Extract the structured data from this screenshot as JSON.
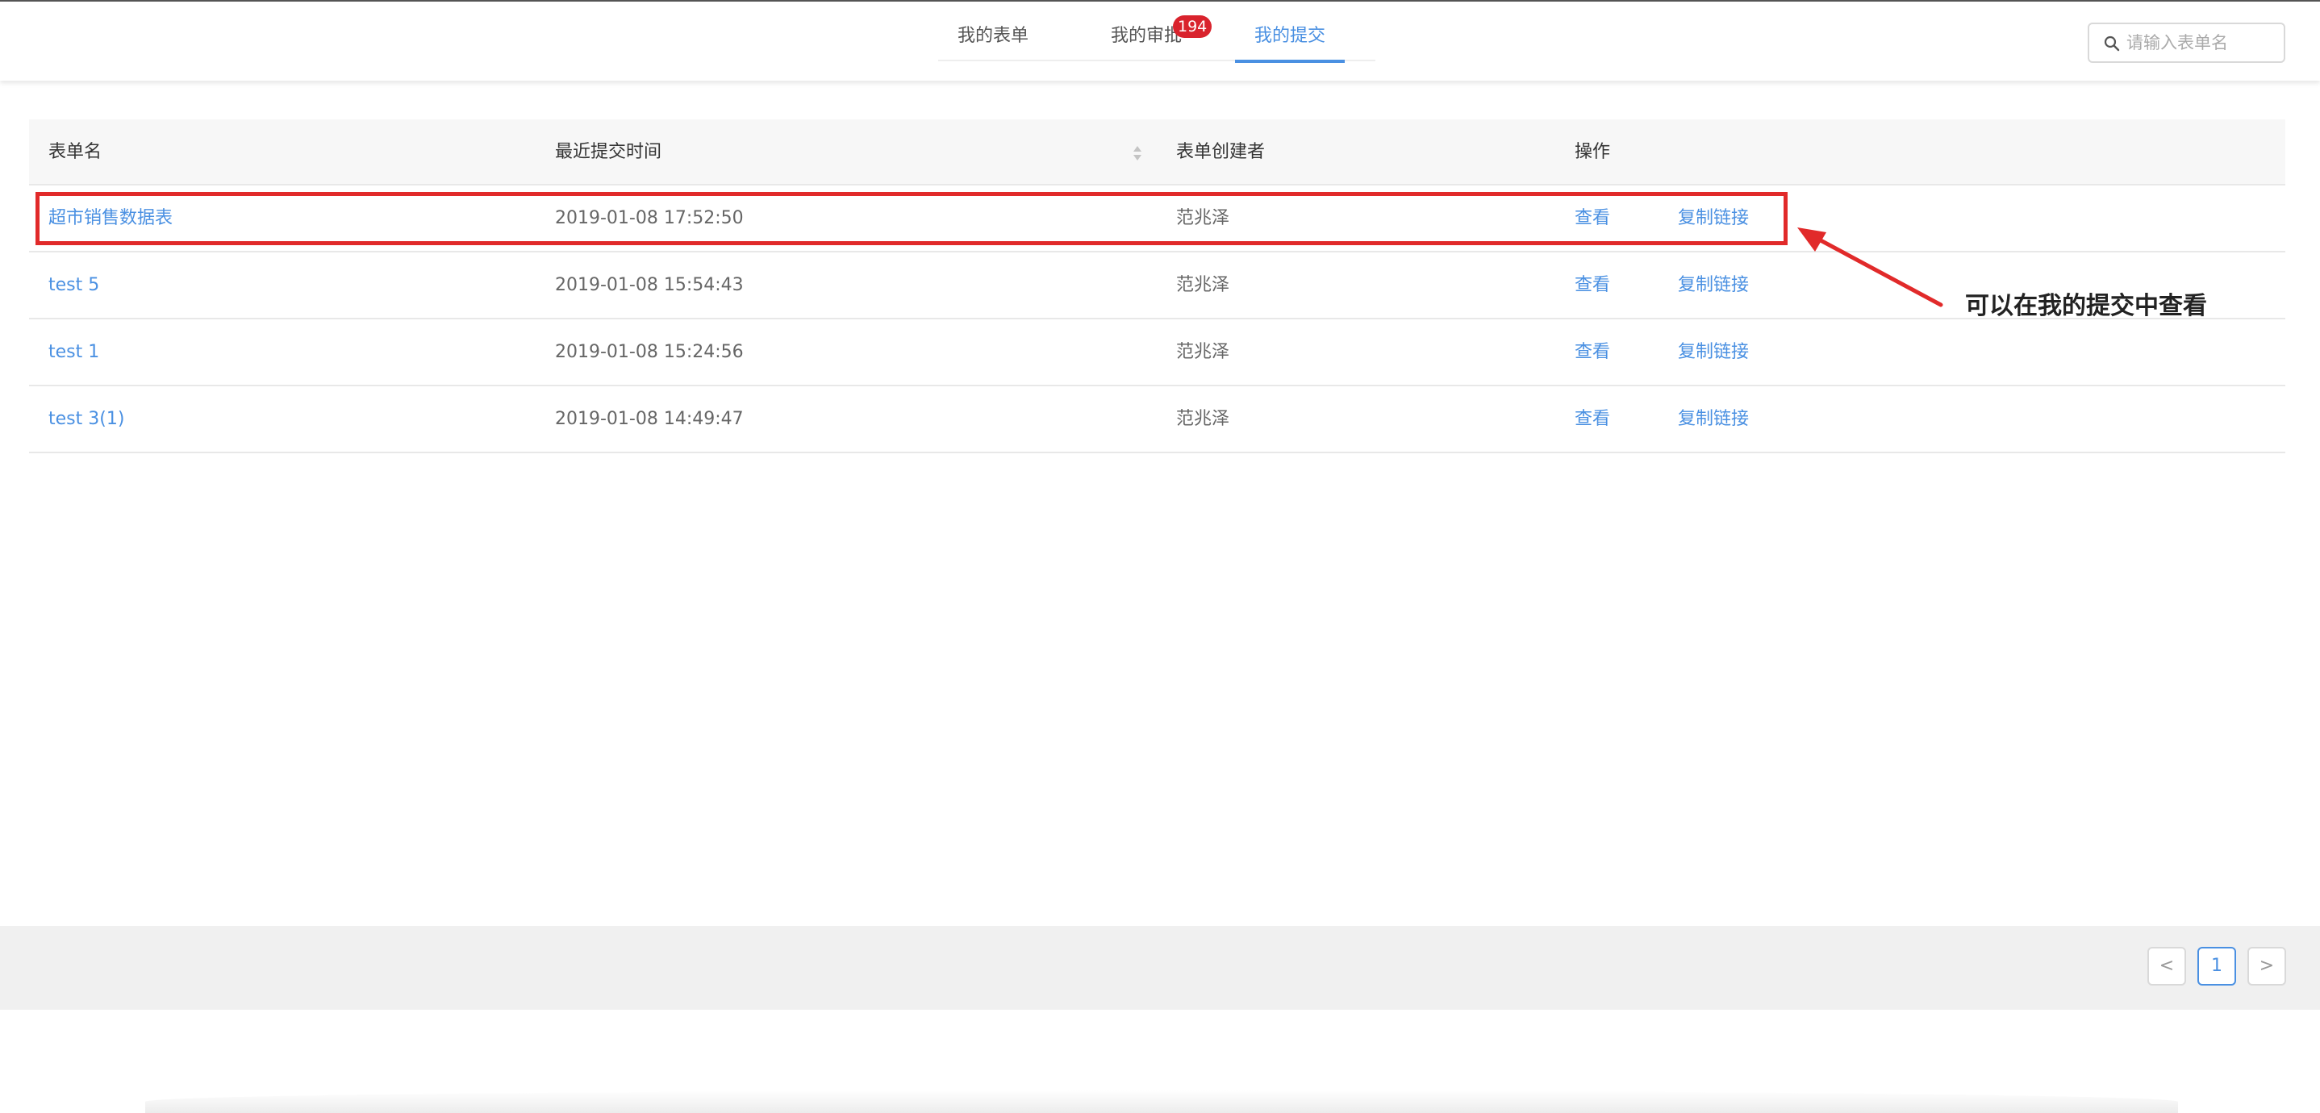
{
  "tabs": [
    {
      "label": "我的表单"
    },
    {
      "label": "我的审批",
      "badge": "194"
    },
    {
      "label": "我的提交",
      "active": true
    }
  ],
  "search": {
    "placeholder": "请输入表单名",
    "value": "",
    "icon": "search-icon"
  },
  "table": {
    "columns": [
      "表单名",
      "最近提交时间",
      "表单创建者",
      "操作"
    ],
    "rows": [
      {
        "name": "超市销售数据表",
        "time": "2019-01-08 17:52:50",
        "creator": "范兆泽",
        "view": "查看",
        "copy": "复制链接"
      },
      {
        "name": "test 5",
        "time": "2019-01-08 15:54:43",
        "creator": "范兆泽",
        "view": "查看",
        "copy": "复制链接"
      },
      {
        "name": "test 1",
        "time": "2019-01-08 15:24:56",
        "creator": "范兆泽",
        "view": "查看",
        "copy": "复制链接"
      },
      {
        "name": "test 3(1)",
        "time": "2019-01-08 14:49:47",
        "creator": "范兆泽",
        "view": "查看",
        "copy": "复制链接"
      }
    ]
  },
  "annotation": {
    "text": "可以在我的提交中查看",
    "color": "#e12a2a"
  },
  "pagination": {
    "prev": "<",
    "current": "1",
    "next": ">"
  },
  "colors": {
    "accent": "#4a90e2",
    "badge": "#d9232d"
  }
}
